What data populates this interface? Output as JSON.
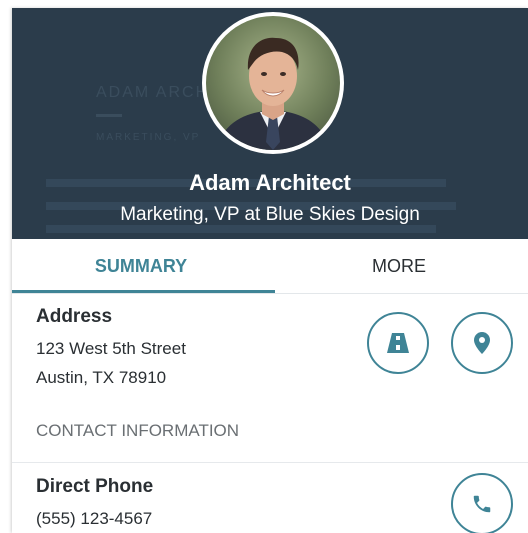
{
  "profile": {
    "name": "Adam Architect",
    "title": "Marketing, VP at Blue Skies Design",
    "ghost_name": "ADAM ARCH",
    "ghost_title": "MARKETING, VP"
  },
  "tabs": [
    {
      "label": "SUMMARY",
      "active": true
    },
    {
      "label": "MORE",
      "active": false
    }
  ],
  "address": {
    "label": "Address",
    "line1": "123 West 5th Street",
    "line2": "Austin, TX 78910",
    "actions": [
      {
        "name": "directions",
        "icon": "road-icon"
      },
      {
        "name": "map",
        "icon": "map-pin-icon"
      }
    ]
  },
  "contact": {
    "section_title": "CONTACT INFORMATION",
    "phone_label": "Direct Phone",
    "phone_value": "(555) 123-4567",
    "phone_icon": "phone-icon"
  },
  "colors": {
    "header_bg": "#2b3c4b",
    "accent": "#3f8496",
    "text": "#2a2f33",
    "muted": "#6a6f73"
  }
}
